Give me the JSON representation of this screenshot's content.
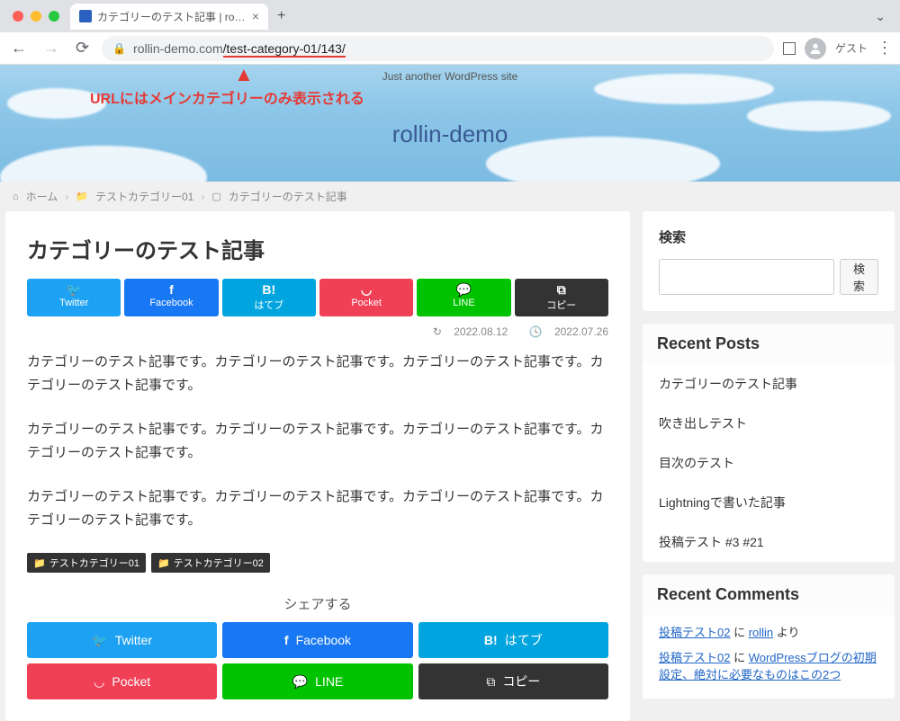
{
  "browser": {
    "tab_title": "カテゴリーのテスト記事 | rollin-d",
    "url_domain": "rollin-demo.com",
    "url_path": "/test-category-01/143/",
    "guest_label": "ゲスト"
  },
  "annotation": {
    "text": "URLにはメインカテゴリーのみ表示される"
  },
  "header": {
    "tagline": "Just another WordPress site",
    "site_title": "rollin-demo"
  },
  "breadcrumb": {
    "home": "ホーム",
    "category": "テストカテゴリー01",
    "page": "カテゴリーのテスト記事"
  },
  "article": {
    "title": "カテゴリーのテスト記事",
    "updated": "2022.08.12",
    "published": "2022.07.26",
    "paragraphs": [
      "カテゴリーのテスト記事です。カテゴリーのテスト記事です。カテゴリーのテスト記事です。カテゴリーのテスト記事です。",
      "カテゴリーのテスト記事です。カテゴリーのテスト記事です。カテゴリーのテスト記事です。カテゴリーのテスト記事です。",
      "カテゴリーのテスト記事です。カテゴリーのテスト記事です。カテゴリーのテスト記事です。カテゴリーのテスト記事です。"
    ],
    "categories": [
      "テストカテゴリー01",
      "テストカテゴリー02"
    ],
    "share_heading": "シェアする"
  },
  "share": {
    "twitter": "Twitter",
    "facebook": "Facebook",
    "hatena": "はてブ",
    "pocket": "Pocket",
    "line": "LINE",
    "copy": "コピー"
  },
  "sidebar": {
    "search_title": "検索",
    "search_button": "検索",
    "recent_posts_title": "Recent Posts",
    "recent_posts": [
      "カテゴリーのテスト記事",
      "吹き出しテスト",
      "目次のテスト",
      "Lightningで書いた記事",
      "投稿テスト #3 #21"
    ],
    "recent_comments_title": "Recent Comments",
    "comments": [
      {
        "post": "投稿テスト02",
        "connector": " に ",
        "author": "rollin",
        "suffix": " より"
      },
      {
        "post": "投稿テスト02",
        "connector": " に ",
        "author": "WordPressブログの初期設定、絶対に必要なものはこの2つ",
        "suffix": ""
      }
    ]
  }
}
